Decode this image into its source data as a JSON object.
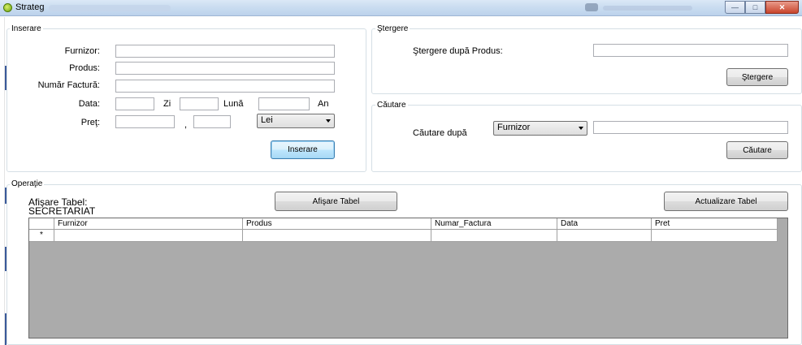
{
  "window": {
    "title": "Strateg"
  },
  "inserare": {
    "group_title": "Inserare",
    "furnizor_label": "Furnizor:",
    "produs_label": "Produs:",
    "numar_factura_label": "Număr Factură:",
    "data_label": "Data:",
    "zi_label": "Zi",
    "luna_label": "Lună",
    "an_label": "An",
    "pret_label": "Preţ:",
    "comma": ",",
    "currency_selected": "Lei",
    "button": "Inserare"
  },
  "stergere": {
    "group_title": "Ştergere",
    "label": "Ştergere după Produs:",
    "button": "Ştergere"
  },
  "cautare": {
    "group_title": "Căutare",
    "label": "Căutare după",
    "field_selected": "Furnizor",
    "button": "Căutare"
  },
  "operatie": {
    "group_title": "Operaţie",
    "afisare_label_line1": "Afişare Tabel:",
    "afisare_label_line2": "SECRETARIAT",
    "afisare_button": "Afişare Tabel",
    "actualizare_button": "Actualizare Tabel"
  },
  "grid": {
    "columns": [
      "Furnizor",
      "Produs",
      "Numar_Factura",
      "Data",
      "Pret"
    ],
    "new_row_marker": "*"
  }
}
